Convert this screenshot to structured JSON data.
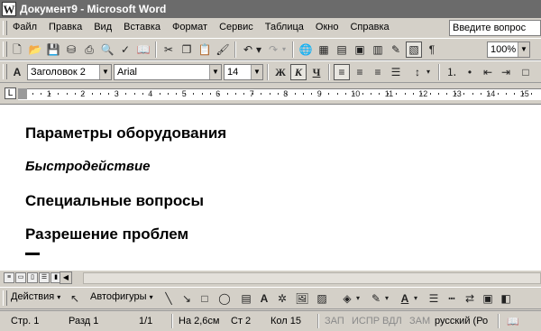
{
  "window": {
    "title": "Документ9 - Microsoft Word",
    "app_icon": "word-icon"
  },
  "menu": [
    "Файл",
    "Правка",
    "Вид",
    "Вставка",
    "Формат",
    "Сервис",
    "Таблица",
    "Окно",
    "Справка"
  ],
  "help_box": "Введите вопрос",
  "standard_toolbar": {
    "zoom": "100%"
  },
  "formatting_toolbar": {
    "style": "Заголовок 2",
    "font": "Arial",
    "size": "14",
    "bold_label": "Ж",
    "italic_label": "К",
    "underline_label": "Ч"
  },
  "ruler": {
    "tab_marker": "L",
    "numbers": [
      "1",
      "2",
      "3",
      "4",
      "5",
      "6",
      "7",
      "8",
      "9",
      "10",
      "11",
      "12",
      "13",
      "14",
      "15"
    ]
  },
  "document": {
    "headings": [
      "Параметры оборудования",
      "Быстродействие",
      "Специальные вопросы",
      "Разрешение проблем"
    ]
  },
  "drawing_toolbar": {
    "actions_label": "Действия",
    "autoshapes_label": "Автофигуры"
  },
  "status_bar": {
    "page": "Стр. 1",
    "section": "Разд 1",
    "pages": "1/1",
    "at": "На 2,6см",
    "line": "Ст 2",
    "column": "Кол 15",
    "rec": "ЗАП",
    "trk": "ИСПР",
    "ext": "ВДЛ",
    "ovr": "ЗАМ",
    "language": "русский (Ро"
  }
}
